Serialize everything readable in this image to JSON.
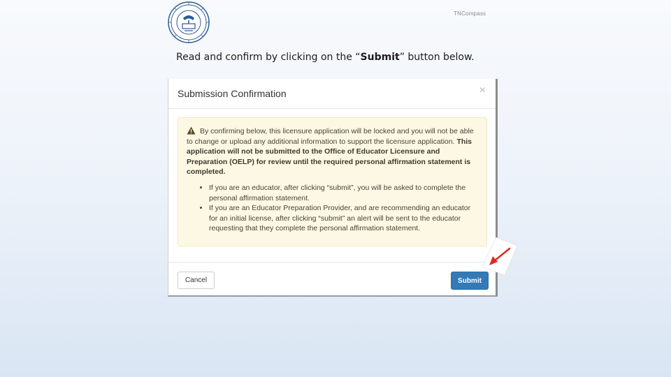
{
  "brand": {
    "text": "TNCompass"
  },
  "seal": {
    "icon": "state-seal-logo",
    "color": "#2b5b96"
  },
  "instruction": {
    "before": "Read and confirm by clicking on the “",
    "bold": "Submit",
    "after": "” button below."
  },
  "modal": {
    "title": "Submission Confirmation",
    "close_symbol": "×",
    "alert": {
      "icon": "warning-triangle-icon",
      "intro": "By confirming below, this licensure application will be locked and you will not be able to change or upload any additional information to support the licensure application.",
      "emphasis": "This application will not be submitted to the Office of Educator Licensure and Preparation (OELP) for review until the required personal affirmation statement is completed.",
      "bullets": [
        "If you are an educator, after clicking “submit”, you will be asked to complete the personal affirmation statement.",
        "If you are an Educator Preparation Provider, and are recommending an educator for an initial license, after clicking “submit” an alert will be sent to the educator requesting that they complete the personal affirmation statement."
      ]
    },
    "footer": {
      "cancel_label": "Cancel",
      "submit_label": "Submit"
    }
  },
  "colors": {
    "submit_button": "#337ab7",
    "alert_background": "#fcf8e3",
    "arrow": "#e02a1f"
  }
}
